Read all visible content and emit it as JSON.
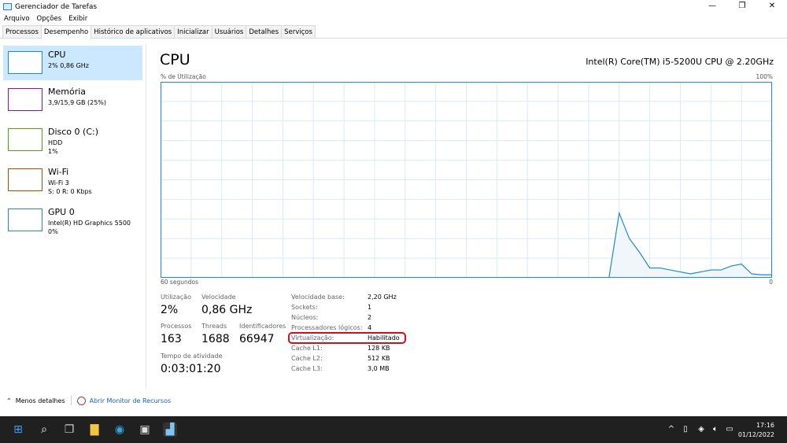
{
  "window": {
    "title": "Gerenciador de Tarefas",
    "minimize": "—",
    "maximize": "❐",
    "close": "✕"
  },
  "menu": [
    "Arquivo",
    "Opções",
    "Exibir"
  ],
  "tabs": [
    {
      "label": "Processos"
    },
    {
      "label": "Desempenho",
      "active": true
    },
    {
      "label": "Histórico de aplicativos"
    },
    {
      "label": "Inicializar"
    },
    {
      "label": "Usuários"
    },
    {
      "label": "Detalhes"
    },
    {
      "label": "Serviços"
    }
  ],
  "sidebar": [
    {
      "title": "CPU",
      "lines": [
        "2% 0,86 GHz"
      ],
      "color": "#1a8ad4"
    },
    {
      "title": "Memória",
      "lines": [
        "3,9/15,9 GB (25%)"
      ],
      "color": "#8b12ae"
    },
    {
      "title": "Disco 0 (C:)",
      "lines": [
        "HDD",
        "1%"
      ],
      "color": "#4da60c"
    },
    {
      "title": "Wi-Fi",
      "lines": [
        "Wi-Fi 3",
        "S: 0 R: 0 Kbps"
      ],
      "color": "#a74f01"
    },
    {
      "title": "GPU 0",
      "lines": [
        "Intel(R) HD Graphics 5500",
        "0%"
      ],
      "color": "#1a8ad4"
    }
  ],
  "main": {
    "title": "CPU",
    "cpu_name": "Intel(R) Core(TM) i5-5200U CPU @ 2.20GHz",
    "y_label": "% de Utilização",
    "y_max": "100%",
    "x_left": "60 segundos",
    "x_right": "0"
  },
  "chart_data": {
    "type": "area",
    "ylim": [
      0,
      100
    ],
    "xlim": [
      60,
      0
    ],
    "grid": true,
    "color": "#1a8ad4",
    "values": [
      0,
      0,
      0,
      0,
      0,
      0,
      0,
      0,
      0,
      0,
      0,
      0,
      0,
      0,
      0,
      0,
      0,
      0,
      0,
      0,
      0,
      0,
      0,
      0,
      0,
      0,
      0,
      0,
      0,
      0,
      0,
      0,
      0,
      0,
      0,
      0,
      0,
      0,
      0,
      0,
      0,
      0,
      0,
      0,
      0,
      33,
      20,
      13,
      5,
      5,
      4,
      3,
      2,
      3,
      4,
      4,
      6,
      7,
      2,
      1.5,
      1.5
    ]
  },
  "stats": {
    "utilizacao": {
      "label": "Utilização",
      "value": "2%"
    },
    "velocidade": {
      "label": "Velocidade",
      "value": "0,86 GHz"
    },
    "processos": {
      "label": "Processos",
      "value": "163"
    },
    "threads": {
      "label": "Threads",
      "value": "1688"
    },
    "identificadores": {
      "label": "Identificadores",
      "value": "66947"
    },
    "tempo": {
      "label": "Tempo de atividade",
      "value": "0:03:01:20"
    }
  },
  "details": [
    {
      "k": "Velocidade base:",
      "v": "2,20 GHz"
    },
    {
      "k": "Sockets:",
      "v": "1"
    },
    {
      "k": "Núcleos:",
      "v": "2"
    },
    {
      "k": "Processadores lógicos:",
      "v": "4"
    },
    {
      "k": "Virtualização:",
      "v": "Habilitado",
      "highlight": "#d0101b"
    },
    {
      "k": "Cache L1:",
      "v": "128 KB"
    },
    {
      "k": "Cache L2:",
      "v": "512 KB"
    },
    {
      "k": "Cache L3:",
      "v": "3,0 MB"
    }
  ],
  "footer": {
    "less": "Menos detalhes",
    "monitor": "Abrir Monitor de Recursos"
  },
  "taskbar": {
    "time": "17:16",
    "date": "01/12/2022"
  }
}
